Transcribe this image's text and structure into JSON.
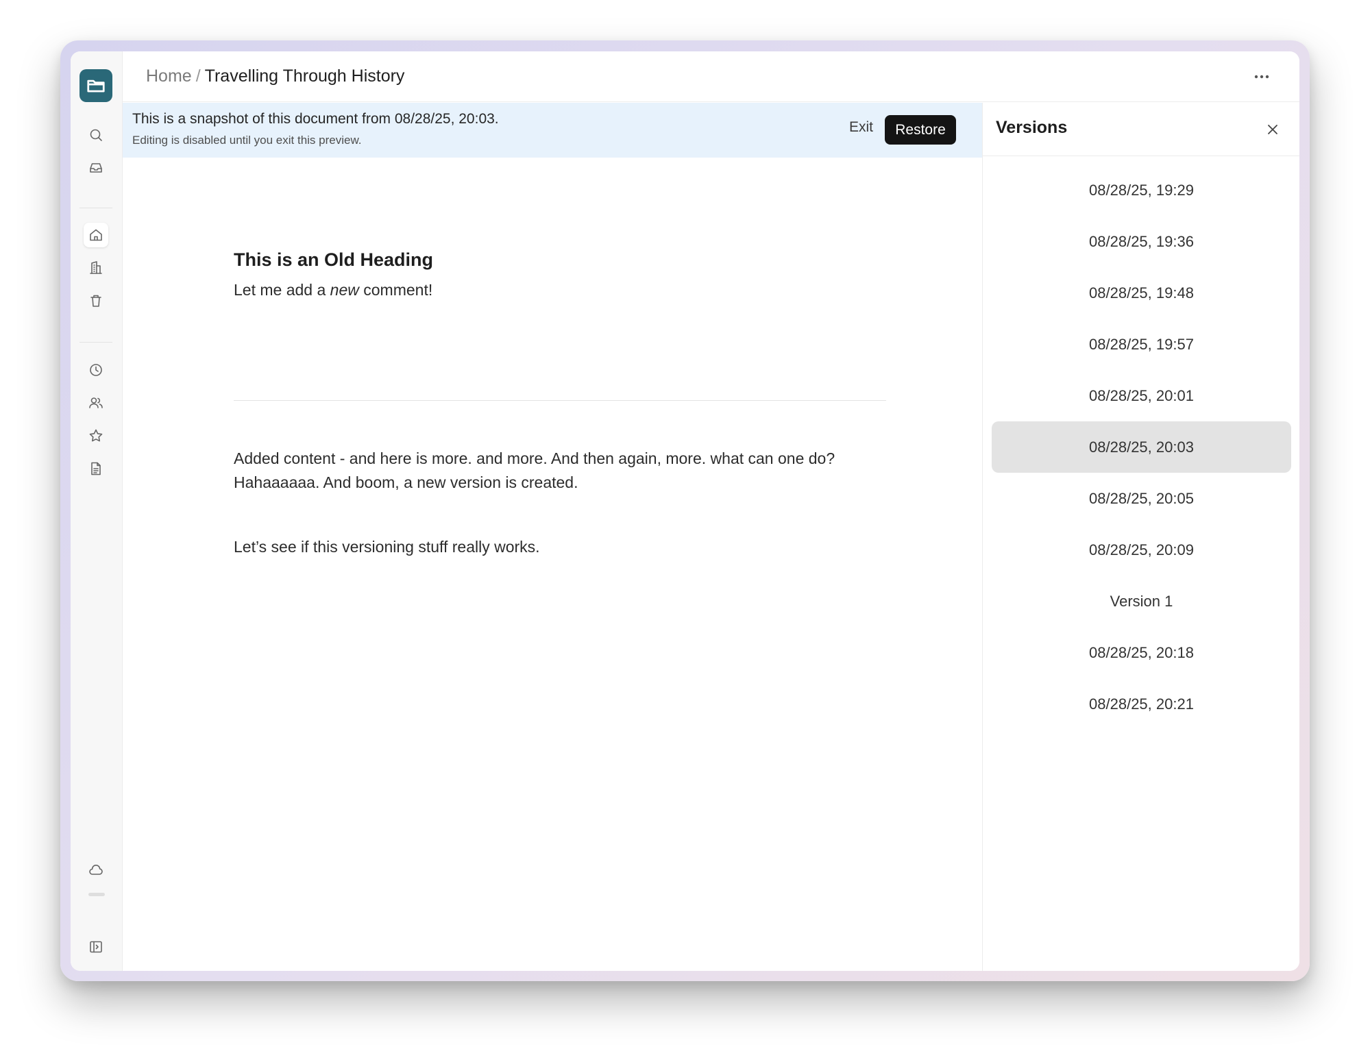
{
  "breadcrumb": {
    "home": "Home",
    "separator": "/",
    "title": "Travelling Through History"
  },
  "banner": {
    "title": "This is a snapshot of this document from 08/28/25, 20:03.",
    "subtitle": "Editing is disabled until you exit this preview.",
    "exit_label": "Exit",
    "restore_label": "Restore"
  },
  "document": {
    "heading": "This is an Old Heading",
    "p1_before": "Let me add a ",
    "p1_em": "new",
    "p1_after": " comment!",
    "p2": "Added content - and here is more. and more. And then again, more. what can one do? Hahaaaaaa. And boom, a new version is created.",
    "p3": "Let’s see if this versioning stuff really works."
  },
  "versions": {
    "title": "Versions",
    "selected_index": 5,
    "items": [
      "08/28/25, 19:29",
      "08/28/25, 19:36",
      "08/28/25, 19:48",
      "08/28/25, 19:57",
      "08/28/25, 20:01",
      "08/28/25, 20:03",
      "08/28/25, 20:05",
      "08/28/25, 20:09",
      "Version 1",
      "08/28/25, 20:18",
      "08/28/25, 20:21"
    ]
  },
  "sidebar": {
    "icons": [
      "folder-icon",
      "search-icon",
      "inbox-icon",
      "home-icon",
      "building-icon",
      "trash-icon",
      "clock-icon",
      "users-icon",
      "star-icon",
      "document-icon",
      "cloud-icon",
      "sidebar-toggle-icon"
    ],
    "active": "home-icon"
  },
  "colors": {
    "logo": "#2a6878",
    "banner": "#e7f2fc",
    "restore": "#141414",
    "selected_version": "#e3e3e3"
  }
}
